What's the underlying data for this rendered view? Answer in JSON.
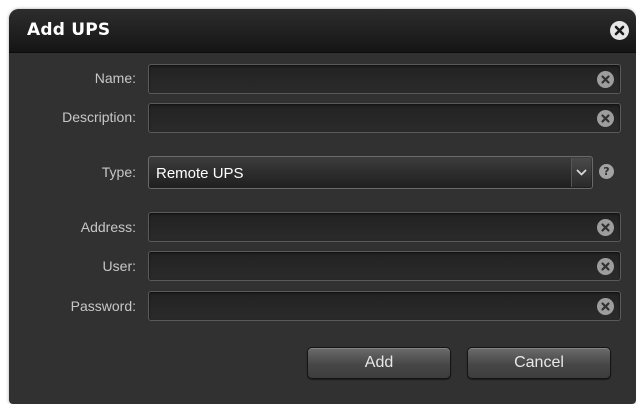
{
  "dialog": {
    "title": "Add UPS"
  },
  "form": {
    "name": {
      "label": "Name:",
      "value": ""
    },
    "description": {
      "label": "Description:",
      "value": ""
    },
    "type": {
      "label": "Type:",
      "selected": "Remote UPS"
    },
    "address": {
      "label": "Address:",
      "value": ""
    },
    "user": {
      "label": "User:",
      "value": ""
    },
    "password": {
      "label": "Password:",
      "value": ""
    }
  },
  "buttons": {
    "add": "Add",
    "cancel": "Cancel"
  },
  "icons": {
    "close": "close-icon",
    "clear": "clear-icon",
    "dropdown": "chevron-down-icon",
    "help": "help-icon"
  },
  "help_glyph": "?",
  "colors": {
    "dialog_bg": "#313131",
    "titlebar_bg": "#151515",
    "label_text": "#c7c7c7",
    "button_face": "#474747"
  }
}
